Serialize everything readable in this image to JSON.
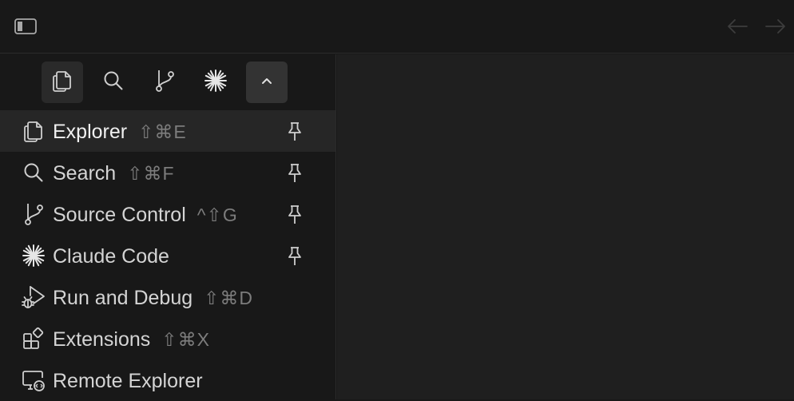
{
  "window": {
    "icons": [
      "sidebar-toggle-icon",
      "back-arrow-icon",
      "forward-arrow-icon"
    ]
  },
  "activity_bar": {
    "buttons": [
      {
        "icon": "files-icon",
        "active": true
      },
      {
        "icon": "search-icon"
      },
      {
        "icon": "source-control-icon"
      },
      {
        "icon": "claude-code-icon"
      },
      {
        "icon": "chevron-up-icon",
        "open": true
      }
    ]
  },
  "menu": {
    "items": [
      {
        "label": "Explorer",
        "shortcut": "⇧⌘E",
        "icon": "files-icon",
        "pinned": true,
        "selected": true
      },
      {
        "label": "Search",
        "shortcut": "⇧⌘F",
        "icon": "search-icon",
        "pinned": true
      },
      {
        "label": "Source Control",
        "shortcut": "^⇧G",
        "icon": "source-control-icon",
        "pinned": true
      },
      {
        "label": "Claude Code",
        "shortcut": "",
        "icon": "claude-code-icon",
        "pinned": true
      },
      {
        "label": "Run and Debug",
        "shortcut": "⇧⌘D",
        "icon": "run-debug-icon",
        "pinned": false
      },
      {
        "label": "Extensions",
        "shortcut": "⇧⌘X",
        "icon": "extensions-icon",
        "pinned": false
      },
      {
        "label": "Remote Explorer",
        "shortcut": "",
        "icon": "remote-explorer-icon",
        "pinned": false
      }
    ]
  },
  "colors": {
    "background": "#181818",
    "editor_background": "#1f1f1f",
    "selected_row": "#262626",
    "text": "#d4d4d4",
    "shortcut_text": "#7c7c7c"
  }
}
